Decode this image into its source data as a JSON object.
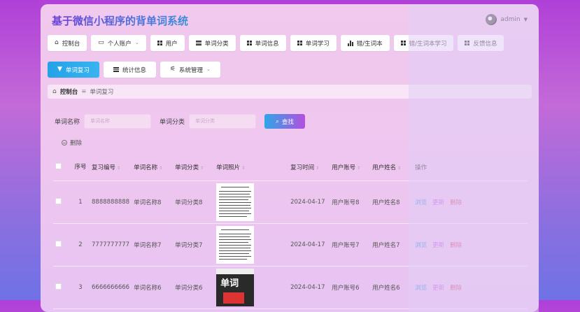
{
  "header": {
    "title": "基于微信小程序的背单词系统",
    "user": "admin"
  },
  "menu_row1": [
    {
      "label": "控制台",
      "icon": "home-icon"
    },
    {
      "label": "个人账户",
      "icon": "account-icon",
      "dropdown": true
    },
    {
      "label": "用户",
      "icon": "grid-icon"
    },
    {
      "label": "单词分类",
      "icon": "list-icon"
    },
    {
      "label": "单词信息",
      "icon": "grid-icon"
    },
    {
      "label": "单词学习",
      "icon": "grid-icon"
    },
    {
      "label": "错/生词本",
      "icon": "chart-icon"
    },
    {
      "label": "错/生词本学习",
      "icon": "grid-icon"
    },
    {
      "label": "反馈信息",
      "icon": "grid-icon"
    }
  ],
  "menu_row2": [
    {
      "label": "单词复习",
      "icon": "bookmark-icon",
      "active": true
    },
    {
      "label": "统计信息",
      "icon": "list-icon"
    },
    {
      "label": "系统管理",
      "icon": "settings-icon",
      "dropdown": true
    }
  ],
  "breadcrumb": {
    "home": "控制台",
    "current": "单词复习"
  },
  "search": {
    "name_label": "单词名称",
    "name_placeholder": "单词名称",
    "cat_label": "单词分类",
    "cat_placeholder": "单词分类",
    "button": "查找"
  },
  "delete_label": "删除",
  "table": {
    "headers": [
      "序号",
      "复习编号",
      "单词名称",
      "单词分类",
      "单词照片",
      "复习时间",
      "用户账号",
      "用户姓名",
      "操作"
    ],
    "rows": [
      {
        "idx": "1",
        "code": "8888888888",
        "name": "单词名称8",
        "cat": "单词分类8",
        "time": "2024-04-17",
        "account": "用户账号8",
        "uname": "用户姓名8"
      },
      {
        "idx": "2",
        "code": "7777777777",
        "name": "单词名称7",
        "cat": "单词分类7",
        "time": "2024-04-17",
        "account": "用户账号7",
        "uname": "用户姓名7"
      },
      {
        "idx": "3",
        "code": "6666666666",
        "name": "单词名称6",
        "cat": "单词分类6",
        "time": "2024-04-17",
        "account": "用户账号6",
        "uname": "用户姓名6"
      }
    ],
    "actions": {
      "view": "浏览",
      "edit": "更新",
      "delete": "删除"
    }
  },
  "thumb3_text": "单词"
}
